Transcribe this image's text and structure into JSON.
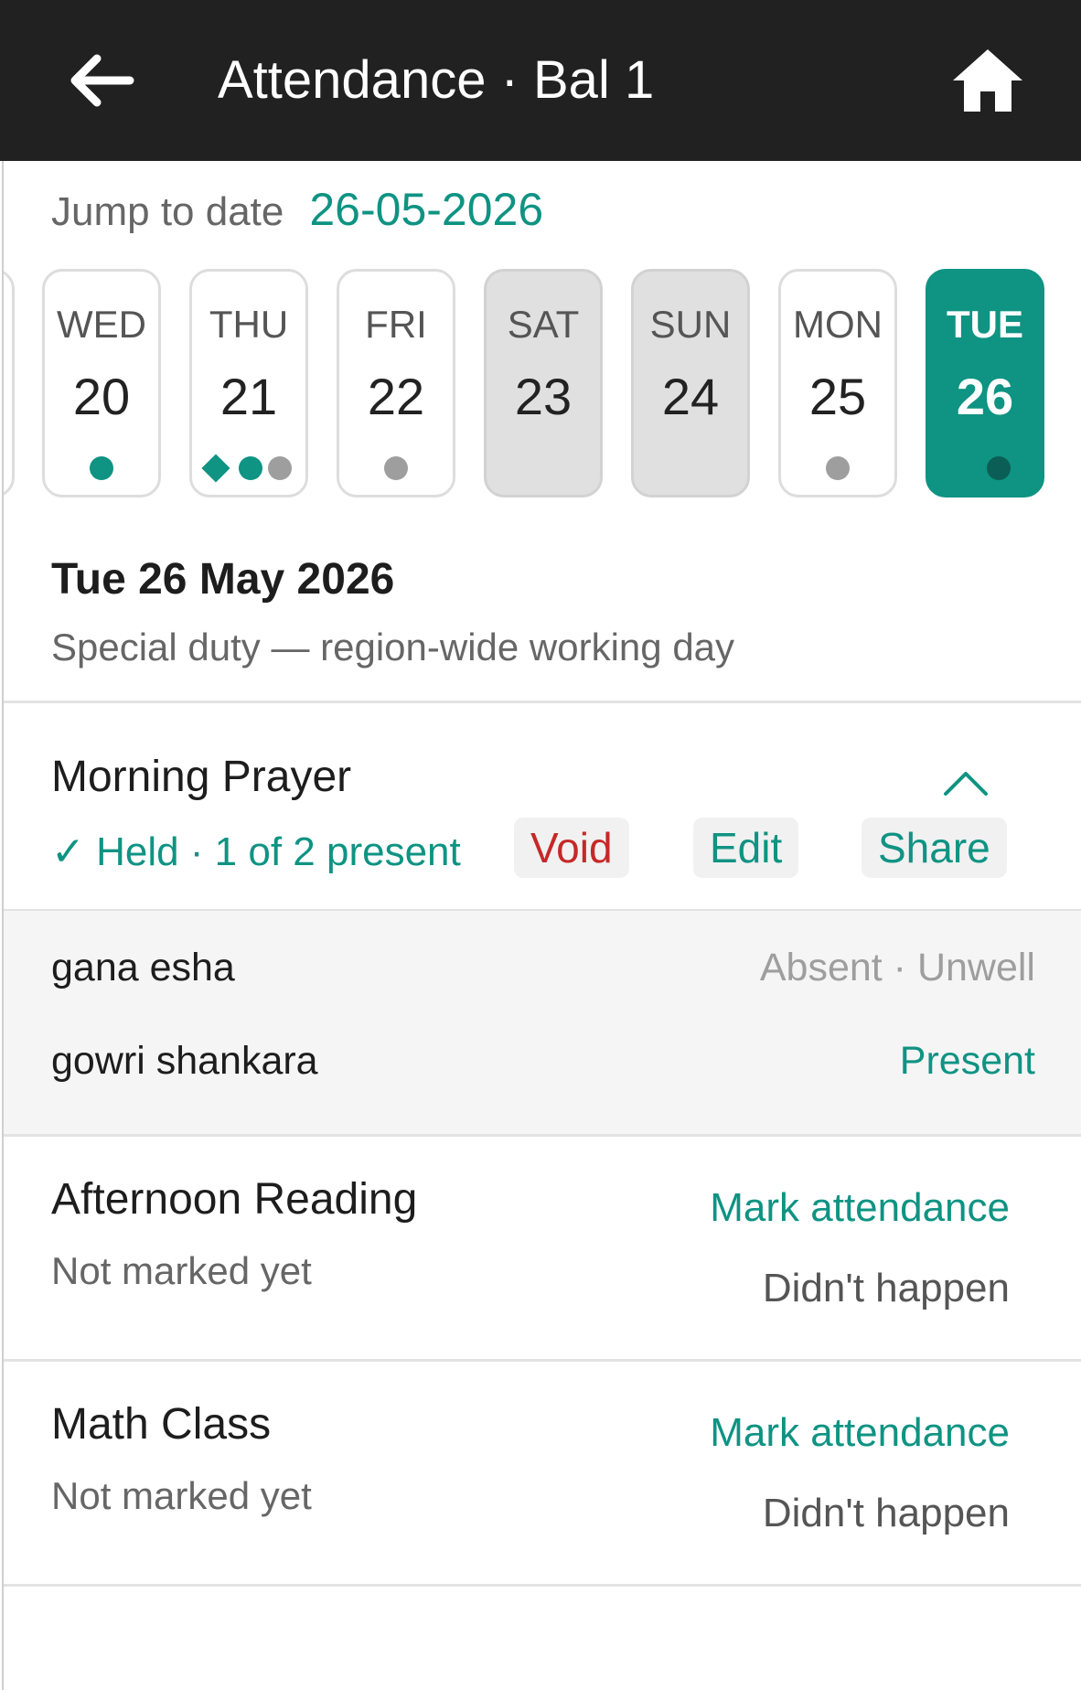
{
  "header": {
    "title": "Attendance · Bal 1",
    "back_icon": "arrow-left-icon",
    "home_icon": "home-icon"
  },
  "jump": {
    "label": "Jump to date",
    "value": "26-05-2026"
  },
  "days": [
    {
      "dow": "WED",
      "num": "20",
      "marks": [
        "dot-green"
      ]
    },
    {
      "dow": "THU",
      "num": "21",
      "marks": [
        "diamond-green",
        "dot-green",
        "dot-grey"
      ]
    },
    {
      "dow": "FRI",
      "num": "22",
      "marks": [
        "dot-grey"
      ]
    },
    {
      "dow": "SAT",
      "num": "23",
      "marks": [],
      "weekend": true
    },
    {
      "dow": "SUN",
      "num": "24",
      "marks": [],
      "weekend": true
    },
    {
      "dow": "MON",
      "num": "25",
      "marks": [
        "dot-grey"
      ]
    },
    {
      "dow": "TUE",
      "num": "26",
      "marks": [
        "dot-dark"
      ],
      "selected": true
    }
  ],
  "selected_day": {
    "heading": "Tue 26 May 2026",
    "note": "Special duty — region-wide working day"
  },
  "sessions": [
    {
      "title": "Morning Prayer",
      "status": "✓ Held · 1 of 2 present",
      "actions": {
        "void": "Void",
        "edit": "Edit",
        "share": "Share"
      },
      "expanded": true,
      "roster": [
        {
          "name": "gana esha",
          "status": "Absent · Unwell"
        },
        {
          "name": "gowri shankara",
          "status": "Present"
        }
      ]
    },
    {
      "title": "Afternoon Reading",
      "status": "Not marked yet",
      "mark": "Mark attendance",
      "skip": "Didn't happen"
    },
    {
      "title": "Math Class",
      "status": "Not marked yet",
      "mark": "Mark attendance",
      "skip": "Didn't happen"
    }
  ],
  "colors": {
    "accent": "#0f9383",
    "danger": "#c62828",
    "topbar": "#212121"
  }
}
